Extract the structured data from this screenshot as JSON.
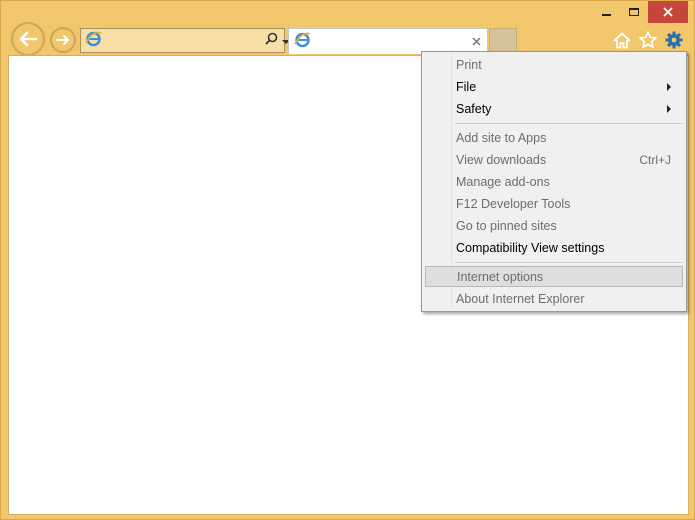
{
  "window": {
    "caption": {
      "minimize": "minimize",
      "maximize": "maximize",
      "close": "close"
    }
  },
  "address_bar": {
    "value": "",
    "placeholder": ""
  },
  "tab": {
    "title": ""
  },
  "colors": {
    "frame": "#f2c66a",
    "close_button": "#c7463c",
    "gear_accent": "#2a6fb0",
    "menu_background": "#f0f0f0",
    "menu_hover": "#dedede"
  },
  "icons": {
    "back": "arrow-left-icon",
    "forward": "arrow-right-icon",
    "site": "ie-logo-icon",
    "search": "search-icon",
    "dropdown": "chevron-down-icon",
    "refresh": "refresh-icon",
    "tab_close": "close-icon",
    "home": "home-icon",
    "favorites": "star-icon",
    "tools": "gear-icon"
  },
  "tools_menu": {
    "items": [
      {
        "label": "Print",
        "enabled": false
      },
      {
        "label": "File",
        "enabled": true,
        "submenu": true
      },
      {
        "label": "Safety",
        "enabled": true,
        "submenu": true
      },
      {
        "label": "Add site to Apps",
        "enabled": false
      },
      {
        "label": "View downloads",
        "enabled": false,
        "shortcut": "Ctrl+J"
      },
      {
        "label": "Manage add-ons",
        "enabled": false
      },
      {
        "label": "F12 Developer Tools",
        "enabled": false
      },
      {
        "label": "Go to pinned sites",
        "enabled": false
      },
      {
        "label": "Compatibility View settings",
        "enabled": true
      },
      {
        "label": "Internet options",
        "enabled": false,
        "highlighted": true
      },
      {
        "label": "About Internet Explorer",
        "enabled": false
      }
    ]
  }
}
